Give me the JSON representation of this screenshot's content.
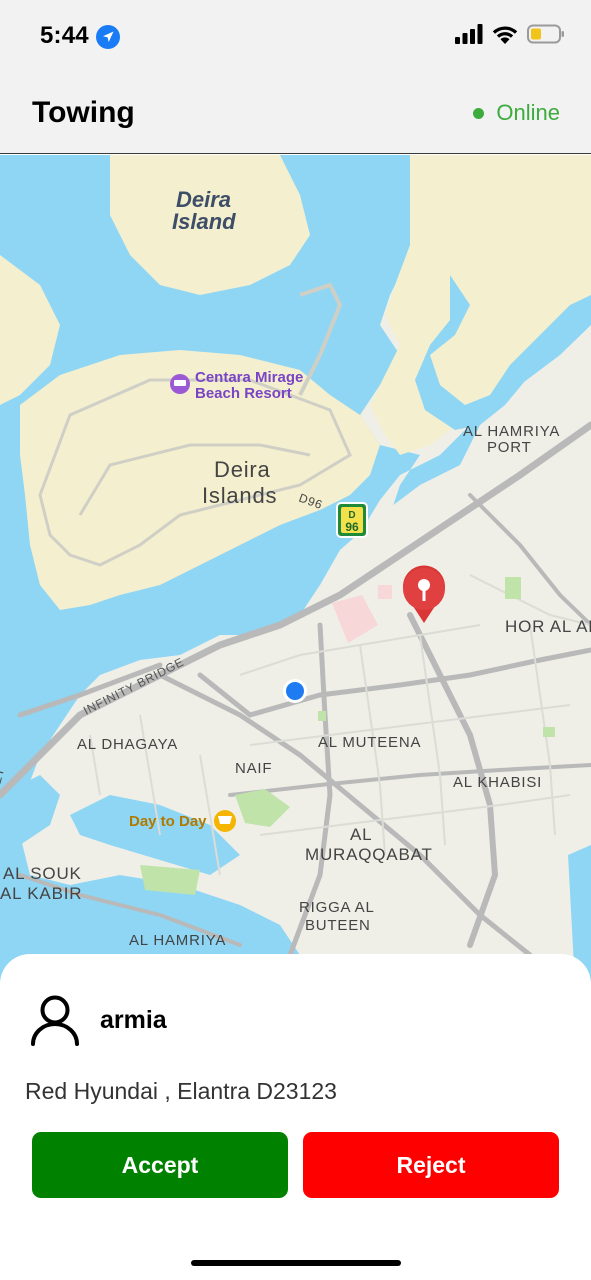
{
  "status_bar": {
    "time": "5:44"
  },
  "header": {
    "title": "Towing",
    "status": "Online",
    "status_color": "#3dab3d"
  },
  "map": {
    "labels": {
      "deira_island": [
        "Deira",
        "Island"
      ],
      "centara": [
        "Centara Mirage",
        "Beach Resort"
      ],
      "deira_islands": [
        "Deira",
        "Islands"
      ],
      "road_d96": "D96",
      "shield_d96": [
        "D",
        "96"
      ],
      "al_hamriya_port": [
        "AL HAMRIYA",
        "PORT"
      ],
      "hor_al_anz": "HOR AL AN",
      "infinity_bridge": "INFINITY BRIDGE",
      "al_dhagaya": "AL DHAGAYA",
      "al_muteena": "AL MUTEENA",
      "naif": "NAIF",
      "al_khabisi": "AL KHABISI",
      "day_to_day": "Day to Day",
      "al_muraqqabat": [
        "AL",
        "MURAQQABAT"
      ],
      "al_souk_al_kabir": [
        "AL SOUK",
        "AL KABIR"
      ],
      "rigga_al_buteen": [
        "RIGGA AL",
        "BUTEEN"
      ],
      "al_hamriya": "AL HAMRIYA",
      "edge_text": "ET"
    },
    "colors": {
      "water": "#8fd6f4",
      "land": "#efefe8",
      "sand": "#f4efcf",
      "pin": "#d93636",
      "user_location": "#1e7bf2"
    }
  },
  "request_sheet": {
    "user_name": "armia",
    "vehicle": "Red Hyundai , Elantra D23123",
    "accept_label": "Accept",
    "reject_label": "Reject",
    "accept_color": "#008200",
    "reject_color": "#ff0000"
  }
}
